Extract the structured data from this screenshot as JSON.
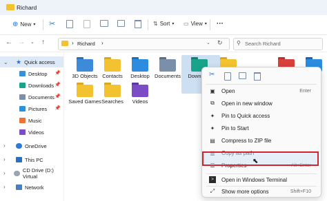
{
  "window": {
    "title": "Richard"
  },
  "toolbar": {
    "new_label": "New",
    "sort_label": "Sort",
    "view_label": "View",
    "more_label": "···"
  },
  "address": {
    "path_root": "›",
    "path_segment": "Richard",
    "search_placeholder": "Search Richard"
  },
  "sidebar": {
    "items": [
      {
        "label": "Quick access"
      },
      {
        "label": "Desktop"
      },
      {
        "label": "Downloads"
      },
      {
        "label": "Documents"
      },
      {
        "label": "Pictures"
      },
      {
        "label": "Music"
      },
      {
        "label": "Videos"
      },
      {
        "label": "OneDrive"
      },
      {
        "label": "This PC"
      },
      {
        "label": "CD Drive (D:) Virtual"
      },
      {
        "label": "Network"
      }
    ]
  },
  "folders": [
    {
      "label": "3D Objects"
    },
    {
      "label": "Contacts"
    },
    {
      "label": "Desktop"
    },
    {
      "label": "Documents"
    },
    {
      "label": "Download"
    },
    {
      "label": "Saved Games"
    },
    {
      "label": "Searches"
    },
    {
      "label": "Videos"
    }
  ],
  "context_menu": {
    "items": [
      {
        "label": "Open",
        "shortcut": "Enter"
      },
      {
        "label": "Open in new window",
        "shortcut": ""
      },
      {
        "label": "Pin to Quick access",
        "shortcut": ""
      },
      {
        "label": "Pin to Start",
        "shortcut": ""
      },
      {
        "label": "Compress to ZIP file",
        "shortcut": ""
      },
      {
        "label": "Copy as path",
        "shortcut": ""
      },
      {
        "label": "Properties",
        "shortcut": "Alt+Enter"
      },
      {
        "label": "Open in Windows Terminal",
        "shortcut": ""
      },
      {
        "label": "Show more options",
        "shortcut": "Shift+F10"
      }
    ]
  },
  "colors": {
    "accent": "#1a73e8",
    "highlight_border": "#d1242f",
    "folder": "#f3c230"
  }
}
